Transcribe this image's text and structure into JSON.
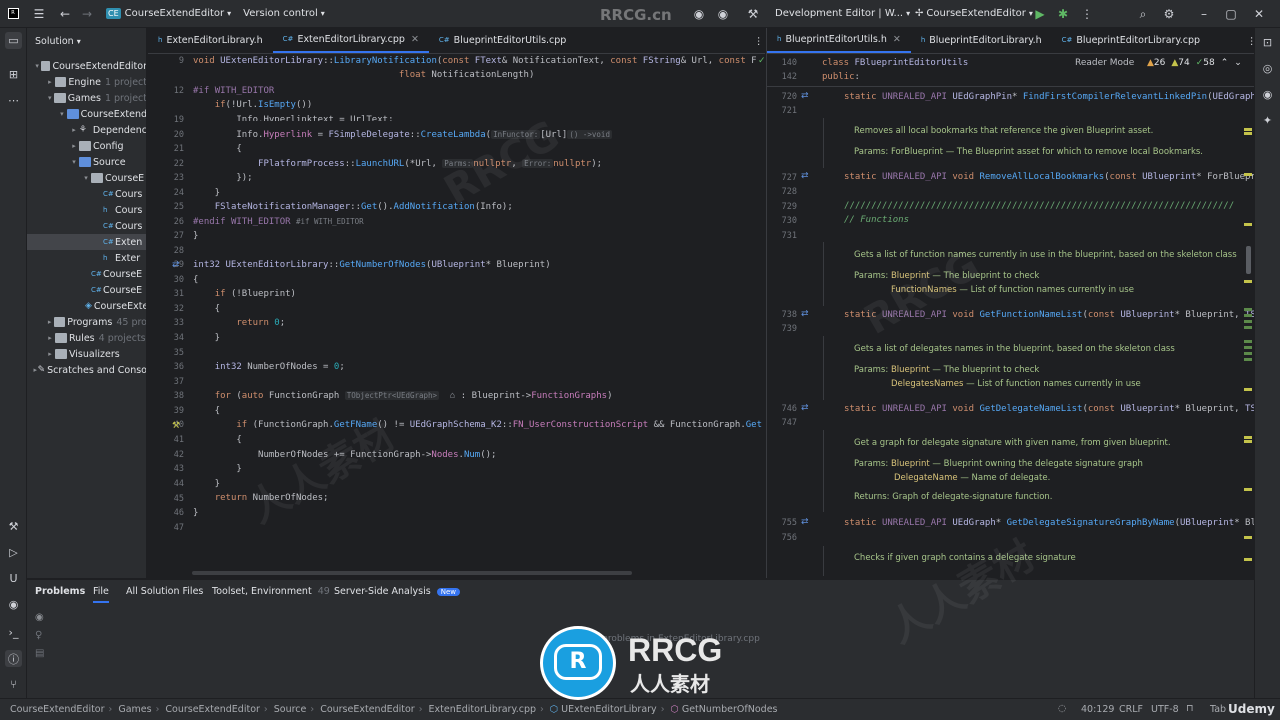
{
  "titlebar": {
    "project_badge": "CE",
    "project_name": "CourseExtendEditor",
    "vcs": "Version control",
    "build_config": "Development Editor | W...",
    "run_target": "CourseExtendEditor",
    "watermark": "RRCG.cn"
  },
  "solution": {
    "header": "Solution",
    "items": [
      {
        "label": "CourseExtendEditor",
        "sub": ""
      },
      {
        "label": "Engine",
        "sub": "1 project"
      },
      {
        "label": "Games",
        "sub": "1 project"
      },
      {
        "label": "CourseExtend",
        "sub": ""
      },
      {
        "label": "Dependenc",
        "sub": ""
      },
      {
        "label": "Config",
        "sub": ""
      },
      {
        "label": "Source",
        "sub": ""
      },
      {
        "label": "CourseE",
        "sub": ""
      },
      {
        "label": "Cours",
        "sub": ""
      },
      {
        "label": "Cours",
        "sub": ""
      },
      {
        "label": "Cours",
        "sub": ""
      },
      {
        "label": "Exten",
        "sub": ""
      },
      {
        "label": "Exter",
        "sub": ""
      },
      {
        "label": "CourseE",
        "sub": ""
      },
      {
        "label": "CourseE",
        "sub": ""
      },
      {
        "label": "CourseExte",
        "sub": ""
      },
      {
        "label": "Programs",
        "sub": "45 pro"
      },
      {
        "label": "Rules",
        "sub": "4 projects"
      },
      {
        "label": "Visualizers",
        "sub": ""
      },
      {
        "label": "Scratches and Conso",
        "sub": ""
      }
    ]
  },
  "editor_left": {
    "tabs": [
      "ExtenEditorLibrary.h",
      "ExtenEditorLibrary.cpp",
      "BlueprintEditorUtils.cpp"
    ],
    "lines": [
      "9",
      "",
      "12",
      "",
      "",
      "20",
      "21",
      "22",
      "23",
      "24",
      "25",
      "26",
      "27",
      "28",
      "29",
      "30",
      "31",
      "32",
      "33",
      "34",
      "35",
      "36",
      "37",
      "38",
      "39",
      "40",
      "41",
      "42",
      "43",
      "44",
      "45",
      "46",
      "47"
    ]
  },
  "editor_right": {
    "tabs": [
      "BlueprintEditorUtils.h",
      "BlueprintEditorLibrary.h",
      "BlueprintEditorLibrary.cpp"
    ],
    "reader_mode": "Reader Mode",
    "warnings": "26",
    "weak_warnings": "74",
    "infos": "58",
    "lines": [
      "140",
      "142",
      "720",
      "721",
      "727",
      "728",
      "729",
      "730",
      "731",
      "738",
      "739",
      "746",
      "747",
      "755",
      "756"
    ],
    "code": {
      "l140": "class FBlueprintEditorUtils",
      "l142": "public:",
      "l720": "static UNREALED_API UEdGraphPin* FindFirstCompilerRelevantLinkedPin(UEdGraphP",
      "l727": "static UNREALED_API void RemoveAllLocalBookmarks(const UBlueprint* ForBluepri",
      "l729": "////////////////////////////////////////////////////////////////////////",
      "l730": "// Functions",
      "l738": "static UNREALED_API void GetFunctionNameList(const UBlueprint* Blueprint, TSe",
      "l746": "static UNREALED_API void GetDelegateNameList(const UBlueprint* Blueprint, TSe",
      "l755": "static UNREALED_API UEdGraph* GetDelegateSignatureGraphByName(UBlueprint* Blu"
    },
    "docs": {
      "d1": "Removes all local bookmarks that reference the given Blueprint asset.",
      "d1p_label": "Params:",
      "d1p_name": "ForBlueprint",
      "d1p_desc": "— The Blueprint asset for which to remove local Bookmarks.",
      "d2": "Gets a list of function names currently in use in the blueprint, based on the skeleton class",
      "d2p_label": "Params:",
      "d2p_name1": "Blueprint",
      "d2p_desc1": "— The blueprint to check",
      "d2p_name2": "FunctionNames",
      "d2p_desc2": "— List of function names currently in use",
      "d3": "Gets a list of delegates names in the blueprint, based on the skeleton class",
      "d3p_label": "Params:",
      "d3p_name1": "Blueprint",
      "d3p_desc1": "— The blueprint to check",
      "d3p_name2": "DelegatesNames",
      "d3p_desc2": "— List of function names currently in use",
      "d4": "Get a graph for delegate signature with given name, from given blueprint.",
      "d4p_label": "Params:",
      "d4p_name1": "Blueprint",
      "d4p_desc1": "— Blueprint owning the delegate signature graph",
      "d4p_name2": "DelegateName",
      "d4p_desc2": "— Name of delegate.",
      "d4r_label": "Returns:",
      "d4r_desc": "Graph of delegate-signature function.",
      "d5": "Checks if given graph contains a delegate signature"
    }
  },
  "bottom": {
    "tabs": [
      "Problems",
      "File",
      "All Solution Files",
      "Toolset, Environment",
      "Server-Side Analysis"
    ],
    "toolset_count": "49",
    "new_badge": "New",
    "message": "No problems in ExtenEditorLibrary.cpp"
  },
  "statusbar": {
    "crumbs": [
      "CourseExtendEditor",
      "Games",
      "CourseExtendEditor",
      "Source",
      "CourseExtendEditor",
      "ExtenEditorLibrary.cpp",
      "UExtenEditorLibrary",
      "GetNumberOfNodes"
    ],
    "position": "40:129",
    "line_endings": "CRLF",
    "encoding": "UTF-8",
    "indent": "Tab",
    "brand": "Udemy"
  },
  "overlay": {
    "logo_text": "RRCG",
    "logo_sub": "人人素材",
    "watermark_cn": "人人素材"
  }
}
